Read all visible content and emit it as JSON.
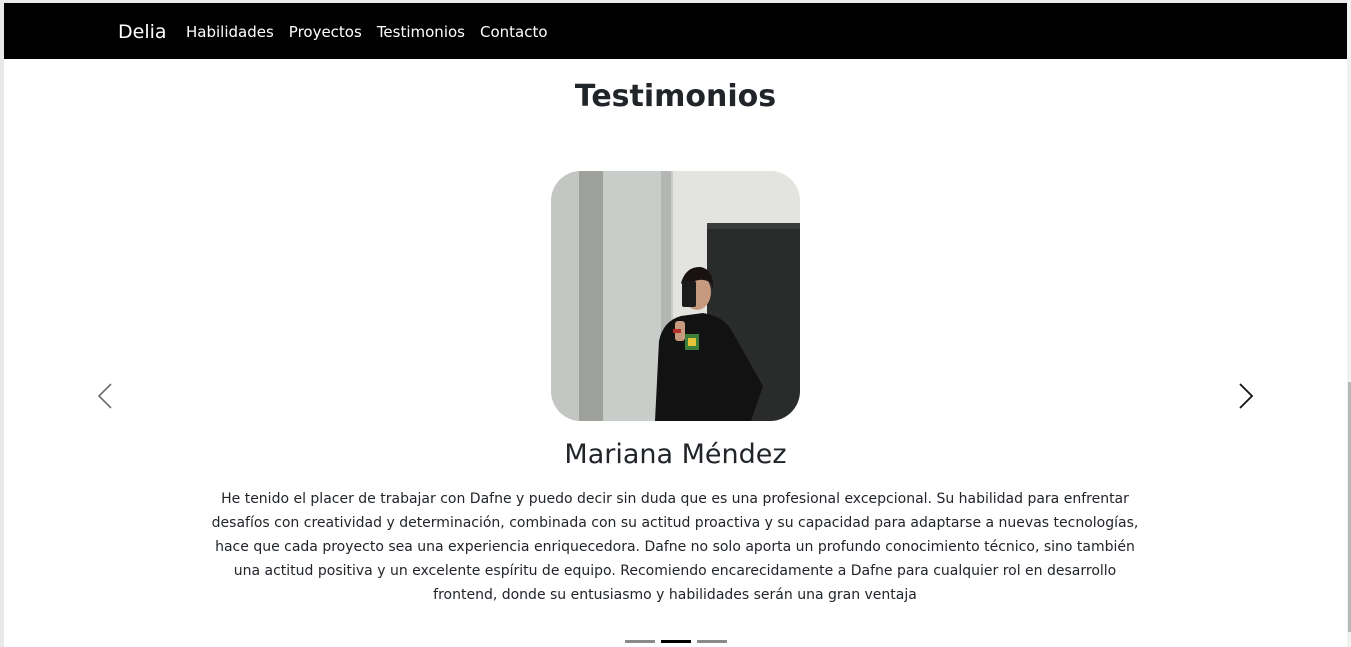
{
  "navbar": {
    "brand": "Delia",
    "links": [
      "Habilidades",
      "Proyectos",
      "Testimonios",
      "Contacto"
    ]
  },
  "section": {
    "title": "Testimonios"
  },
  "carousel": {
    "prev_icon": "chevron-left-icon",
    "next_icon": "chevron-right-icon",
    "active_index": 1,
    "indicator_count": 3,
    "slide": {
      "photo": "mirror-selfie-photo",
      "name": "Mariana Méndez",
      "text": "He tenido el placer de trabajar con Dafne y puedo decir sin duda que es una profesional excepcional. Su habilidad para enfrentar desafíos con creatividad y determinación, combinada con su actitud proactiva y su capacidad para adaptarse a nuevas tecnologías, hace que cada proyecto sea una experiencia enriquecedora. Dafne no solo aporta un profundo conocimiento técnico, sino también una actitud positiva y un excelente espíritu de equipo. Recomiendo encarecidamente a Dafne para cualquier rol en desarrollo frontend, donde su entusiasmo y habilidades serán una gran ventaja"
    }
  },
  "colors": {
    "navbar_bg": "#000000",
    "nav_text": "#ffffff",
    "text": "#212529",
    "indicator_active": "#000000",
    "indicator_inactive": "#8a8a8a"
  }
}
